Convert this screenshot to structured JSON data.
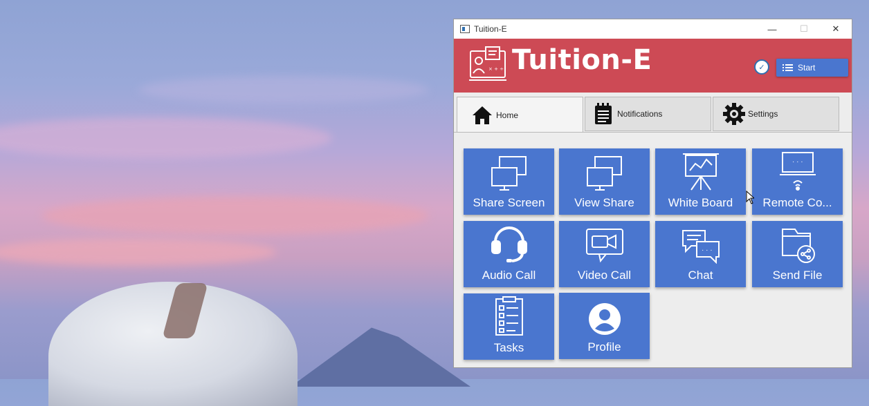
{
  "window": {
    "title": "Tuition-E",
    "minimize": "—",
    "maximize": "☐",
    "close": "✕"
  },
  "header": {
    "app_title": "Tuition-E",
    "start_label": "Start"
  },
  "tabs": [
    {
      "label": "Home",
      "icon": "home-icon",
      "active": true
    },
    {
      "label": "Notifications",
      "icon": "notepad-icon",
      "active": false
    },
    {
      "label": "Settings",
      "icon": "gear-icon",
      "active": false
    }
  ],
  "tiles": [
    {
      "label": "Share Screen",
      "icon": "share-screen-icon"
    },
    {
      "label": "View Share",
      "icon": "view-share-icon"
    },
    {
      "label": "White Board",
      "icon": "whiteboard-icon"
    },
    {
      "label": "Remote Co...",
      "icon": "remote-control-icon"
    },
    {
      "label": "Audio Call",
      "icon": "headset-icon"
    },
    {
      "label": "Video Call",
      "icon": "video-camera-icon"
    },
    {
      "label": "Chat",
      "icon": "chat-icon"
    },
    {
      "label": "Send File",
      "icon": "send-file-icon"
    },
    {
      "label": "Tasks",
      "icon": "tasks-icon"
    },
    {
      "label": "Profile",
      "icon": "profile-icon"
    }
  ],
  "colors": {
    "header": "#cd4a55",
    "accent": "#4a76cf",
    "tile_text": "#ffffff"
  }
}
